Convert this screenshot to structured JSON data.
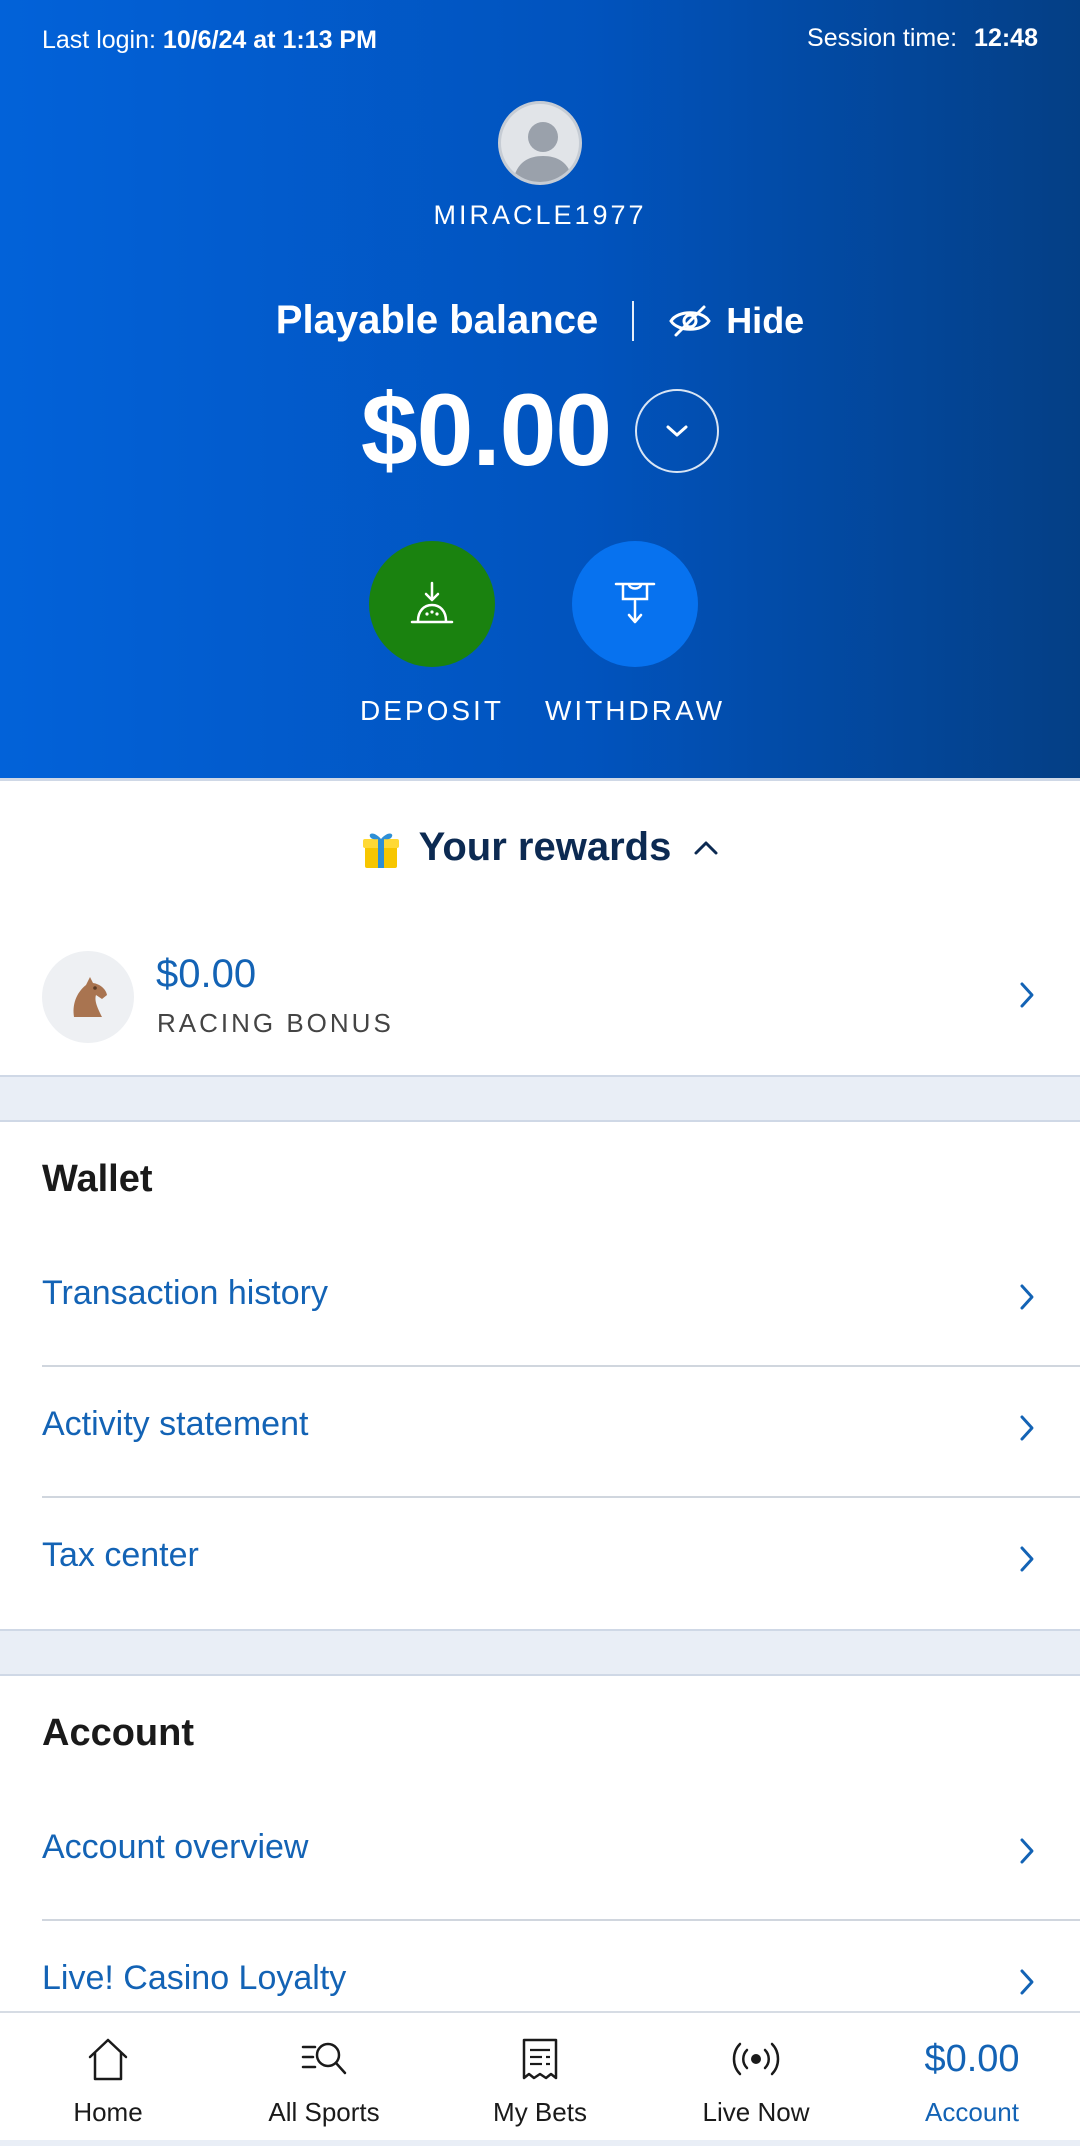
{
  "colors": {
    "hero_start": "#0262d9",
    "hero_end": "#043f85",
    "deposit": "#1a820f",
    "withdraw": "#0772ef",
    "link": "#1363b5",
    "rewards_title": "#0c2a52",
    "band": "#e9eef6"
  },
  "header": {
    "last_login_label": "Last login:",
    "last_login_value": "10/6/24 at 1:13 PM",
    "session_label": "Session time:",
    "session_value": "12:48"
  },
  "profile": {
    "avatar_icon": "user-avatar-icon",
    "username": "MIRACLE1977"
  },
  "balance": {
    "label": "Playable balance",
    "hide_label": "Hide",
    "hide_icon": "eye-off-icon",
    "amount": "$0.00",
    "toggle_icon": "chevron-down-icon"
  },
  "actions": {
    "deposit_label": "DEPOSIT",
    "deposit_icon": "deposit-icon",
    "withdraw_label": "WITHDRAW",
    "withdraw_icon": "withdraw-icon"
  },
  "rewards": {
    "title": "Your rewards",
    "icon": "gift-icon",
    "toggle_icon": "chevron-up-icon",
    "items": [
      {
        "amount": "$0.00",
        "label": "RACING BONUS",
        "icon": "horse-icon"
      }
    ]
  },
  "wallet": {
    "title": "Wallet",
    "items": [
      {
        "label": "Transaction history"
      },
      {
        "label": "Activity statement"
      },
      {
        "label": "Tax center"
      }
    ]
  },
  "account": {
    "title": "Account",
    "items": [
      {
        "label": "Account overview"
      },
      {
        "label": "Live! Casino Loyalty"
      }
    ]
  },
  "bottom_nav": {
    "items": [
      {
        "label": "Home",
        "icon": "home-icon"
      },
      {
        "label": "All Sports",
        "icon": "search-sports-icon"
      },
      {
        "label": "My Bets",
        "icon": "bet-slip-icon"
      },
      {
        "label": "Live Now",
        "icon": "live-broadcast-icon"
      },
      {
        "label": "Account",
        "balance": "$0.00",
        "active": true
      }
    ]
  }
}
